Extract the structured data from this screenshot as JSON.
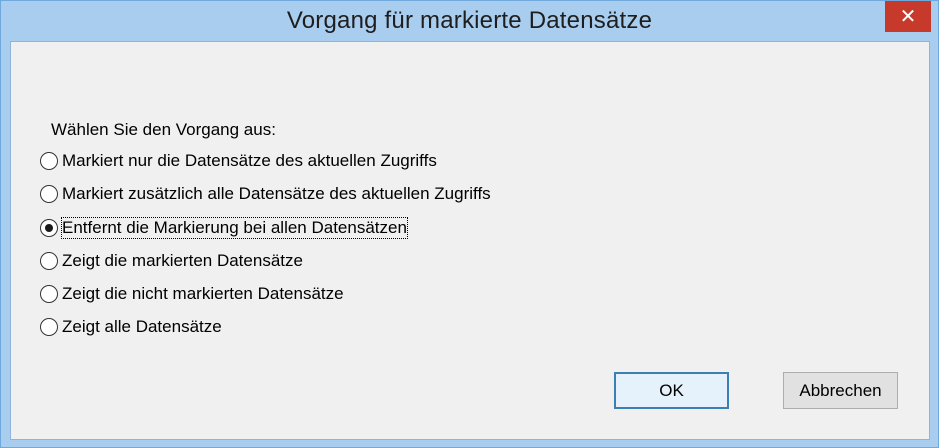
{
  "window": {
    "title": "Vorgang für markierte Datensätze",
    "close_symbol": "✕"
  },
  "dialog": {
    "prompt": "Wählen Sie den Vorgang aus:",
    "options": [
      {
        "label": "Markiert nur die Datensätze des aktuellen Zugriffs",
        "selected": false
      },
      {
        "label": "Markiert zusätzlich alle Datensätze des aktuellen Zugriffs",
        "selected": false
      },
      {
        "label": "Entfernt die Markierung bei allen Datensätzen",
        "selected": true
      },
      {
        "label": "Zeigt die markierten Datensätze",
        "selected": false
      },
      {
        "label": "Zeigt die nicht markierten Datensätze",
        "selected": false
      },
      {
        "label": "Zeigt alle Datensätze",
        "selected": false
      }
    ],
    "ok_label": "OK",
    "cancel_label": "Abbrechen"
  },
  "colors": {
    "titlebar": "#a9cdef",
    "close_button": "#c7392b",
    "client_background": "#f0f0f0"
  }
}
